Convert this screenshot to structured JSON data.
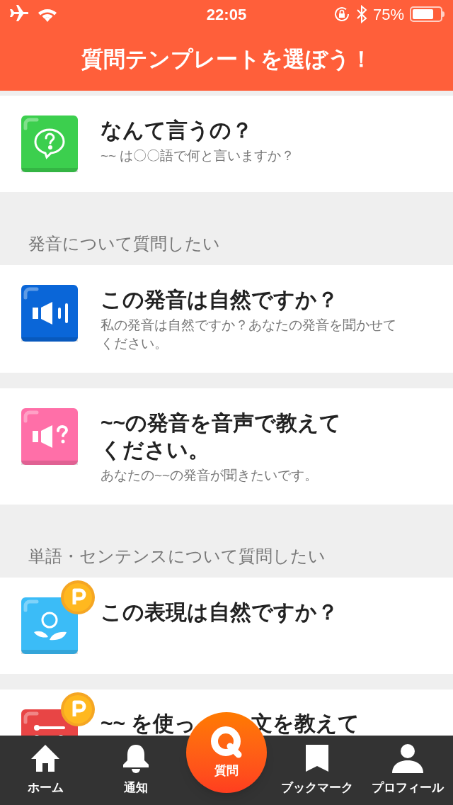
{
  "status_bar": {
    "time": "22:05",
    "battery_text": "75%",
    "battery": {
      "level": 0.75
    }
  },
  "header": {
    "title": "質問テンプレートを選ぼう！"
  },
  "sections": [
    {
      "items": [
        {
          "kind": "speech-question",
          "color": "#3ccf4e",
          "title": "なんて言うの？",
          "subtitle": "~~ は〇〇語で何と言いますか？",
          "premium": false
        }
      ]
    },
    {
      "heading": "発音について質問したい",
      "items": [
        {
          "kind": "speaker",
          "color": "#0a66d8",
          "title": "この発音は自然ですか？",
          "subtitle": "私の発音は自然ですか？あなたの発音を聞かせてください。",
          "premium": false
        },
        {
          "kind": "speaker-question",
          "color": "#ff6fa8",
          "title": "~~の発音を音声で教えてください。",
          "subtitle": "あなたの~~の発音が聞きたいです。",
          "premium": false
        }
      ]
    },
    {
      "heading": "単語・センテンスについて質問したい",
      "items": [
        {
          "kind": "flower",
          "color": "#3bbcf7",
          "title": "この表現は自然ですか？",
          "premium": true
        },
        {
          "kind": "sliders",
          "color": "#e84545",
          "title": "~~ を使っ",
          "title_after_cover": "文を教えて",
          "premium": true
        }
      ]
    }
  ],
  "tab_bar": {
    "items": [
      {
        "kind": "home",
        "label": "ホーム"
      },
      {
        "kind": "bell",
        "label": "通知"
      },
      {
        "kind": "bookmark",
        "label": "ブックマーク"
      },
      {
        "kind": "person",
        "label": "プロフィール"
      }
    ],
    "center_button": {
      "label": "質問"
    }
  }
}
